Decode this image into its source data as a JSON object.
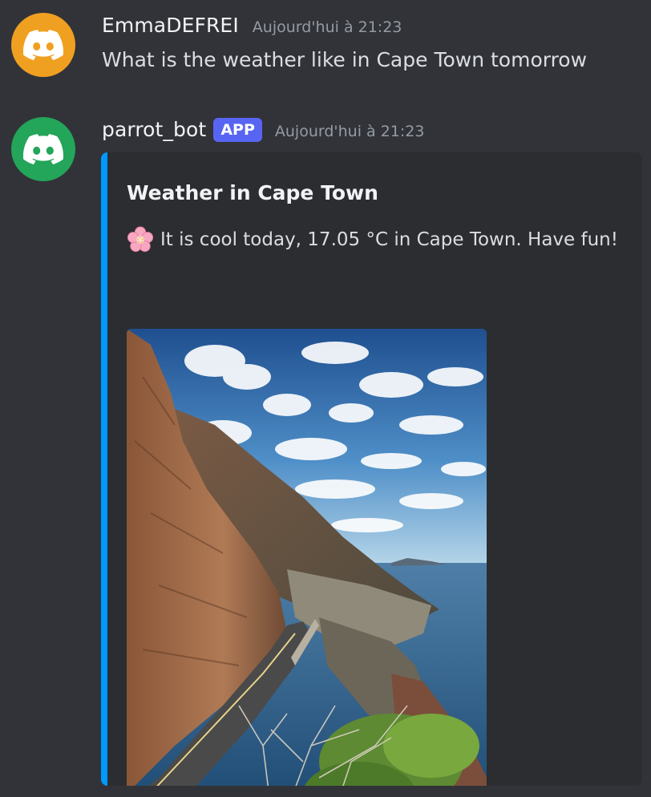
{
  "messages": [
    {
      "username": "EmmaDEFREI",
      "timestamp": "Aujourd'hui à 21:23",
      "content": "What is the weather like in Cape Town tomorrow",
      "avatar_color": "#f0a020",
      "avatar_icon": "discord-logo-icon"
    },
    {
      "username": "parrot_bot",
      "badge": "APP",
      "timestamp": "Aujourd'hui à 21:23",
      "avatar_color": "#23a55a",
      "avatar_icon": "discord-logo-icon",
      "embed": {
        "accent_color": "#0099ff",
        "title": "Weather in Cape Town",
        "description_icon": "cherry-blossom-icon",
        "description": "It is cool today, 17.05 °C in Cape Town. Have fun!",
        "image": "coastal-mountain-road-photo"
      }
    }
  ],
  "colors": {
    "background": "#313338",
    "embed_background": "#2b2d31",
    "badge": "#5865f2",
    "timestamp": "#949ba4"
  }
}
